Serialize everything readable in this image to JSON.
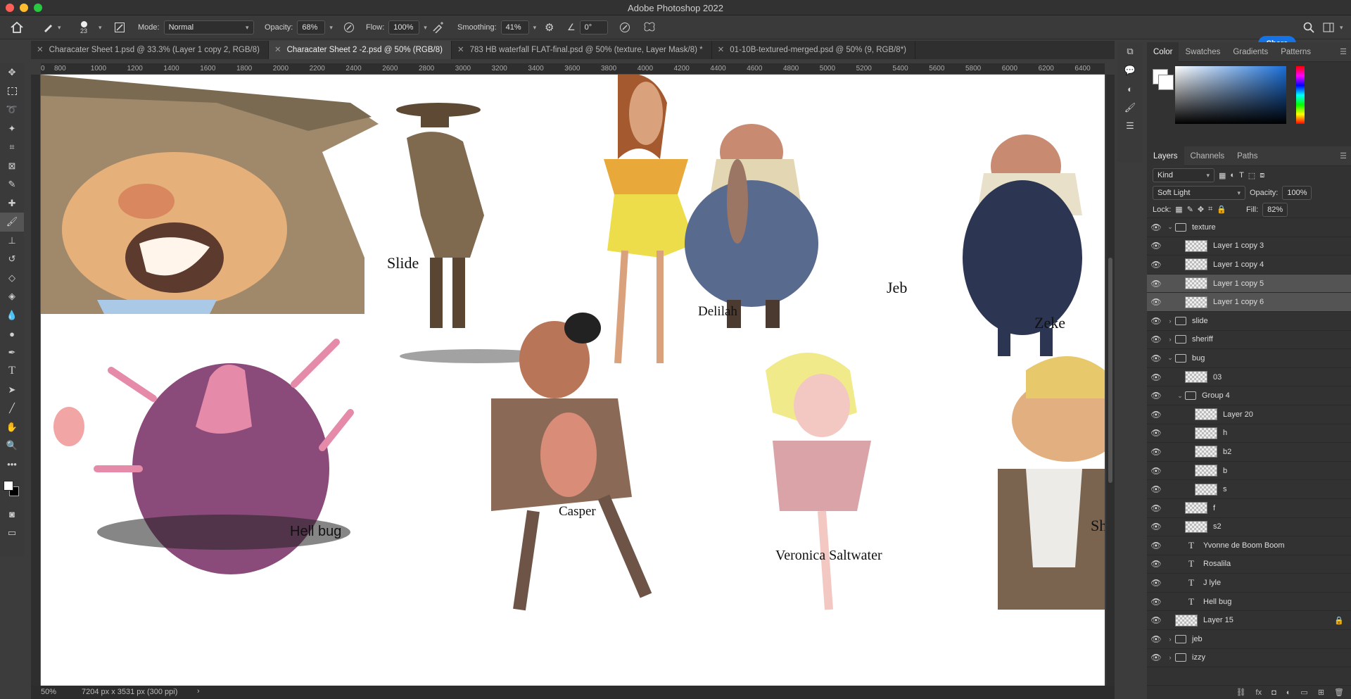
{
  "app": {
    "title": "Adobe Photoshop 2022"
  },
  "options_bar": {
    "brush_size": "23",
    "mode_label": "Mode:",
    "mode_value": "Normal",
    "opacity_label": "Opacity:",
    "opacity_value": "68%",
    "flow_label": "Flow:",
    "flow_value": "100%",
    "smoothing_label": "Smoothing:",
    "smoothing_value": "41%",
    "angle_value": "0°",
    "share_label": "Share"
  },
  "doc_tabs": [
    {
      "label": "Characater Sheet 1.psd @ 33.3% (Layer 1 copy 2, RGB/8)",
      "active": false
    },
    {
      "label": "Characater Sheet 2 -2.psd @ 50% (RGB/8)",
      "active": true
    },
    {
      "label": "783 HB waterfall FLAT-final.psd @ 50% (texture, Layer Mask/8) *",
      "active": false
    },
    {
      "label": "01-10B-textured-merged.psd @ 50% (9, RGB/8*)",
      "active": false
    }
  ],
  "ruler_ticks": [
    "0",
    "800",
    "1000",
    "1200",
    "1400",
    "1600",
    "1800",
    "2000",
    "2200",
    "2400",
    "2600",
    "2800",
    "3000",
    "3200",
    "3400",
    "3600",
    "3800",
    "4000",
    "4200",
    "4400",
    "4600",
    "4800",
    "5000",
    "5200",
    "5400",
    "5600",
    "5800",
    "6000",
    "6200",
    "6400"
  ],
  "canvas_labels": {
    "slide": "Slide",
    "delilah": "Delilah",
    "jeb": "Jeb",
    "zeke": "Zeke",
    "hell_bug": "Hell bug",
    "casper": "Casper",
    "veronica": "Veronica Saltwater",
    "sh": "Sh"
  },
  "status": {
    "zoom": "50%",
    "doc_info": "7204 px x 3531 px (300 ppi)"
  },
  "color_panel": {
    "tabs": [
      "Color",
      "Swatches",
      "Gradients",
      "Patterns"
    ]
  },
  "layers_panel": {
    "tabs": [
      "Layers",
      "Channels",
      "Paths"
    ],
    "filter_kind": "Kind",
    "blend_mode": "Soft Light",
    "opacity_label": "Opacity:",
    "opacity_value": "100%",
    "lock_label": "Lock:",
    "fill_label": "Fill:",
    "fill_value": "82%",
    "layers": [
      {
        "name": "texture",
        "kind": "group-open",
        "indent": 0,
        "selected": false
      },
      {
        "name": "Layer 1 copy 3",
        "kind": "pixel",
        "indent": 1,
        "selected": false
      },
      {
        "name": "Layer 1 copy 4",
        "kind": "pixel",
        "indent": 1,
        "selected": false
      },
      {
        "name": "Layer 1 copy 5",
        "kind": "pixel",
        "indent": 1,
        "selected": true
      },
      {
        "name": "Layer 1 copy 6",
        "kind": "pixel",
        "indent": 1,
        "selected": true
      },
      {
        "name": "slide",
        "kind": "group",
        "indent": 0,
        "selected": false
      },
      {
        "name": "sheriff",
        "kind": "group",
        "indent": 0,
        "selected": false
      },
      {
        "name": "bug",
        "kind": "group-open",
        "indent": 0,
        "selected": false
      },
      {
        "name": "03",
        "kind": "pixel",
        "indent": 1,
        "selected": false
      },
      {
        "name": "Group 4",
        "kind": "group-open",
        "indent": 1,
        "selected": false
      },
      {
        "name": "Layer 20",
        "kind": "pixel",
        "indent": 2,
        "selected": false
      },
      {
        "name": "h",
        "kind": "pixel",
        "indent": 2,
        "selected": false
      },
      {
        "name": "b2",
        "kind": "pixel",
        "indent": 2,
        "selected": false
      },
      {
        "name": "b",
        "kind": "pixel",
        "indent": 2,
        "selected": false
      },
      {
        "name": "s",
        "kind": "pixel",
        "indent": 2,
        "selected": false
      },
      {
        "name": "f",
        "kind": "pixel",
        "indent": 1,
        "selected": false
      },
      {
        "name": "s2",
        "kind": "pixel",
        "indent": 1,
        "selected": false
      },
      {
        "name": "Yvonne de Boom Boom",
        "kind": "text",
        "indent": 1,
        "selected": false
      },
      {
        "name": "Rosalila",
        "kind": "text",
        "indent": 1,
        "selected": false
      },
      {
        "name": "J lyle",
        "kind": "text",
        "indent": 1,
        "selected": false
      },
      {
        "name": "Hell bug",
        "kind": "text",
        "indent": 1,
        "selected": false
      },
      {
        "name": "Layer 15",
        "kind": "pixel-locked",
        "indent": 0,
        "selected": false
      },
      {
        "name": "jeb",
        "kind": "group",
        "indent": 0,
        "selected": false
      },
      {
        "name": "izzy",
        "kind": "group",
        "indent": 0,
        "selected": false
      }
    ]
  }
}
